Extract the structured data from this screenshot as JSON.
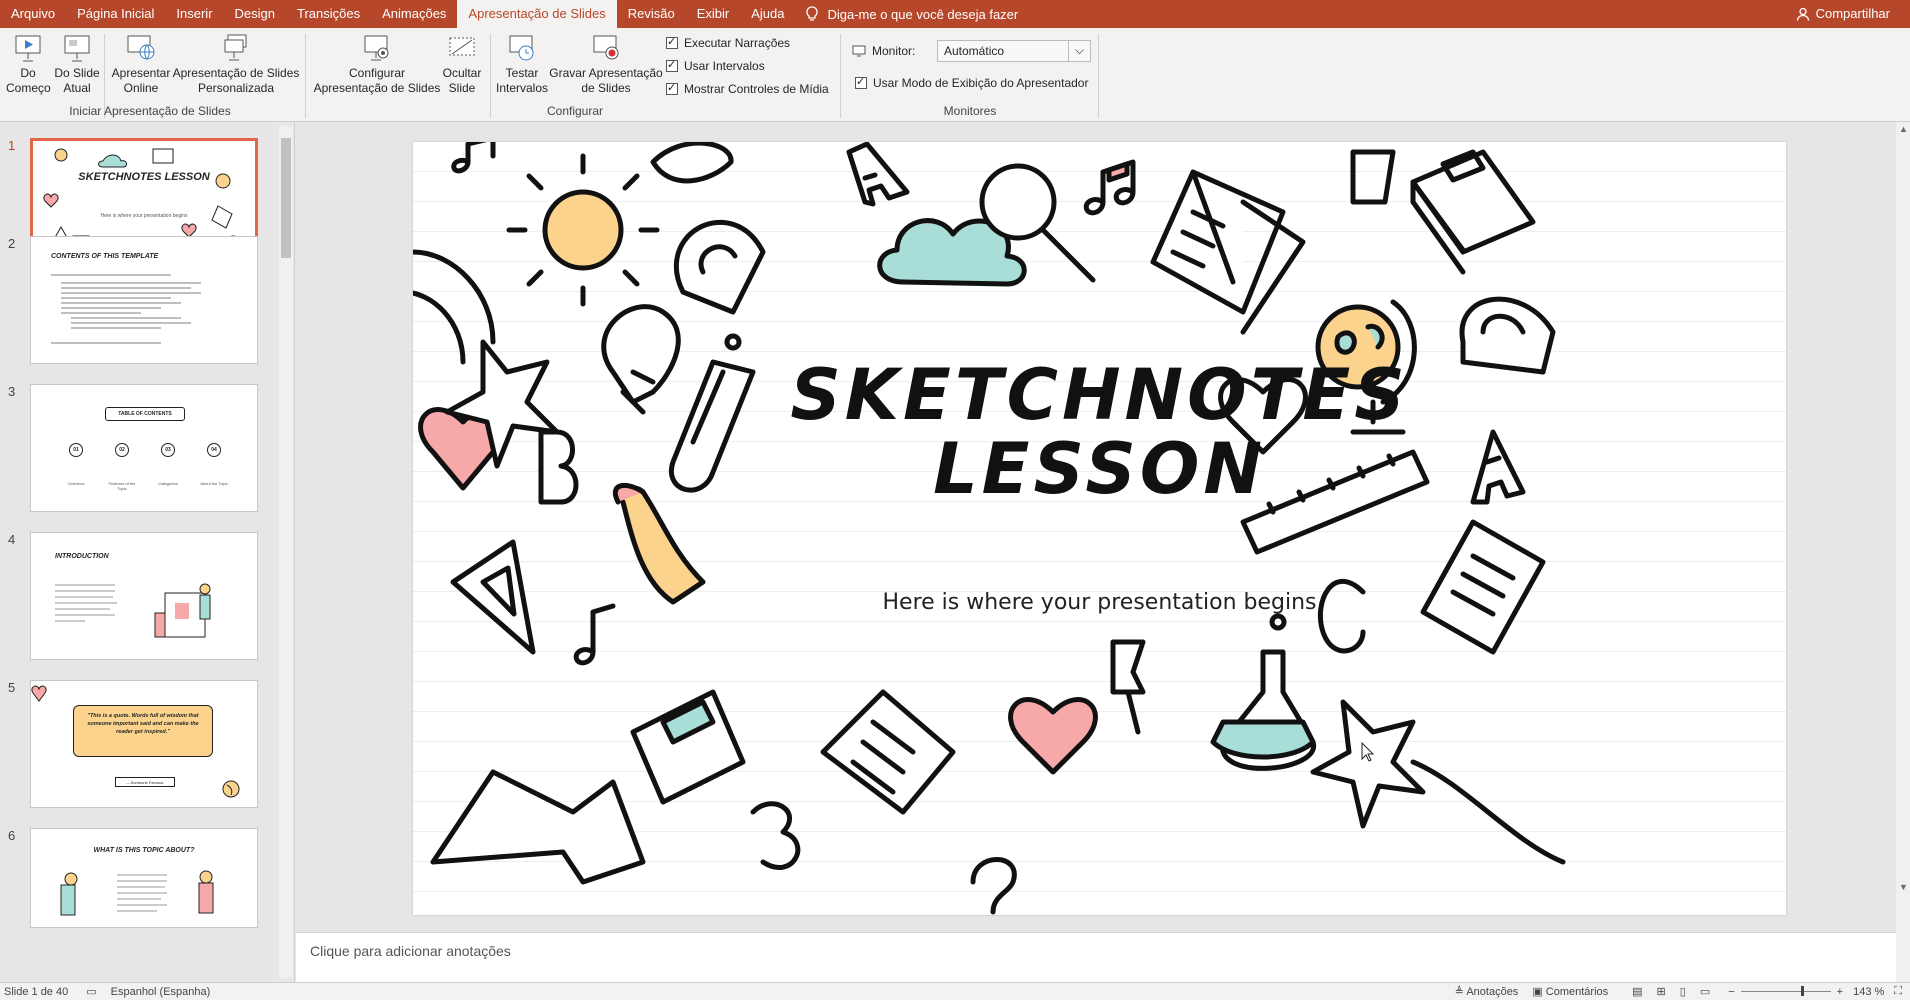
{
  "tabs": [
    "Arquivo",
    "Página Inicial",
    "Inserir",
    "Design",
    "Transições",
    "Animações",
    "Apresentação de Slides",
    "Revisão",
    "Exibir",
    "Ajuda"
  ],
  "active_tab": "Apresentação de Slides",
  "tell_me": "Diga-me o que você deseja fazer",
  "share": "Compartilhar",
  "ribbon": {
    "from_beginning": "Do\nComeço",
    "from_current": "Do Slide\nAtual",
    "present_online": "Apresentar\nOnline",
    "custom_show": "Apresentação de Slides\nPersonalizada",
    "group_start": "Iniciar Apresentação de Slides",
    "setup_show": "Configurar\nApresentação de Slides",
    "hide_slide": "Ocultar\nSlide",
    "rehearse": "Testar\nIntervalos",
    "record": "Gravar Apresentação\nde Slides",
    "play_narrations": "Executar Narrações",
    "use_timings": "Usar Intervalos",
    "show_media_controls": "Mostrar Controles de Mídia",
    "group_setup": "Configurar",
    "monitor_label": "Monitor:",
    "monitor_value": "Automático",
    "presenter_view": "Usar Modo de Exibição do Apresentador",
    "group_monitors": "Monitores"
  },
  "thumbnails": [
    {
      "num": "1",
      "title": "SKETCHNOTES LESSON",
      "sub": "Here is where your presentation begins"
    },
    {
      "num": "2",
      "title": "CONTENTS OF THIS TEMPLATE"
    },
    {
      "num": "3",
      "title": "TABLE OF CONTENTS",
      "items": [
        "01",
        "02",
        "03",
        "04"
      ],
      "labels": [
        "Overview",
        "Features of the Topic",
        "Categories",
        "About the Topic"
      ]
    },
    {
      "num": "4",
      "title": "INTRODUCTION"
    },
    {
      "num": "5",
      "title": "\"This is a quote. Words full of wisdom that someone important said and can make the reader get inspired.\"",
      "author": "—Someone Famous"
    },
    {
      "num": "6",
      "title": "WHAT IS THIS TOPIC ABOUT?"
    }
  ],
  "slide": {
    "title_line1": "SKETCHNOTES",
    "title_line2": "LESSON",
    "subtitle": "Here is where your presentation begins"
  },
  "notes_placeholder": "Clique para adicionar anotações",
  "status": {
    "slide_counter": "Slide 1 de 40",
    "language": "Espanhol (Espanha)",
    "notes": "Anotações",
    "comments": "Comentários",
    "zoom": "143 %"
  },
  "colors": {
    "accent": "#b7472a",
    "teal": "#a8ddd8",
    "yellow": "#fbd38d",
    "pink": "#f7a8a8"
  }
}
